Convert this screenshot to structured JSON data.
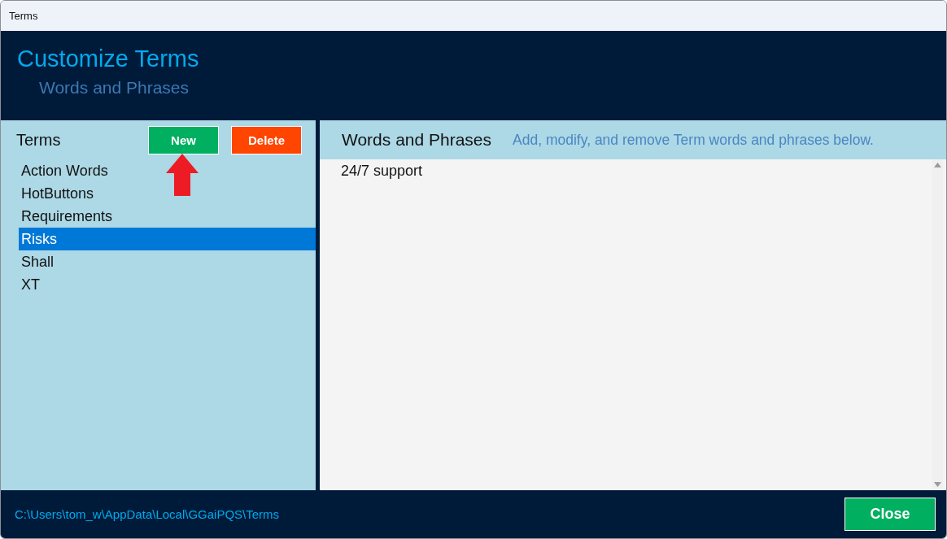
{
  "window": {
    "title": "Terms"
  },
  "header": {
    "title": "Customize Terms",
    "subtitle": "Words and Phrases"
  },
  "terms_panel": {
    "title": "Terms",
    "buttons": [
      {
        "label": "New",
        "kind": "new"
      },
      {
        "label": "Delete",
        "kind": "delete"
      }
    ],
    "items": [
      {
        "label": "Action Words",
        "selected": false
      },
      {
        "label": "HotButtons",
        "selected": false
      },
      {
        "label": "Requirements",
        "selected": false
      },
      {
        "label": "Risks",
        "selected": true
      },
      {
        "label": "Shall",
        "selected": false
      },
      {
        "label": "XT",
        "selected": false
      }
    ]
  },
  "phrases_panel": {
    "title": "Words and Phrases",
    "hint": "Add, modify, and remove Term words and phrases below.",
    "value": "24/7 support"
  },
  "status_bar": {
    "path": "C:\\Users\\tom_w\\AppData\\Local\\GGaiPQS\\Terms",
    "close_button": "Close"
  }
}
